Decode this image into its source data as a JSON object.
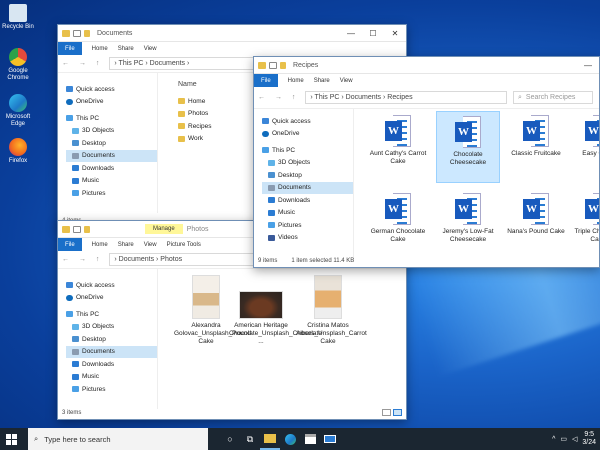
{
  "desktop": {
    "icons": [
      {
        "label": "Recycle Bin",
        "icon": "recycle-bin-icon",
        "color": "#d8e6f2"
      },
      {
        "label": "Google Chrome",
        "icon": "chrome-icon",
        "color": "#e24a3b"
      },
      {
        "label": "Microsoft Edge",
        "icon": "edge-icon",
        "color": "#1fa3c8"
      },
      {
        "label": "Firefox",
        "icon": "firefox-icon",
        "color": "#f36d1e"
      }
    ]
  },
  "docs_window": {
    "title": "Documents",
    "ribbon": [
      "File",
      "Home",
      "Share",
      "View"
    ],
    "path": "› This PC › Documents ›",
    "nav": [
      "Quick access",
      "OneDrive",
      "This PC",
      "3D Objects",
      "Desktop",
      "Documents",
      "Downloads",
      "Music",
      "Pictures"
    ],
    "column_header": "Name",
    "items": [
      "Home",
      "Photos",
      "Recipes",
      "Work"
    ],
    "status": "4 items"
  },
  "photos_window": {
    "title": "Photos",
    "manage_tab": "Manage",
    "ribbon": [
      "File",
      "Home",
      "Share",
      "View"
    ],
    "sub_tab": "Picture Tools",
    "path": "› Documents › Photos",
    "nav": [
      "Quick access",
      "OneDrive",
      "This PC",
      "3D Objects",
      "Desktop",
      "Documents",
      "Downloads",
      "Music",
      "Pictures"
    ],
    "files": [
      {
        "name": "Alexandra Golovac_Unsplash_Pound Cake"
      },
      {
        "name": "American Heritage Chocolate_Unsplash_Chocolate ..."
      },
      {
        "name": "Cristina Matos Albers_Unsplash_Carrot Cake"
      }
    ],
    "status": "3 items"
  },
  "recipes_window": {
    "title": "Recipes",
    "ribbon": [
      "File",
      "Home",
      "Share",
      "View"
    ],
    "path": "› This PC › Documents › Recipes",
    "search_placeholder": "Search Recipes",
    "nav": [
      "Quick access",
      "OneDrive",
      "This PC",
      "3D Objects",
      "Desktop",
      "Documents",
      "Downloads",
      "Music",
      "Pictures",
      "Videos"
    ],
    "files": [
      {
        "name": "Aunt Cathy's Carrot Cake"
      },
      {
        "name": "Chocolate Cheesecake"
      },
      {
        "name": "Classic Fruitcake"
      },
      {
        "name": "Easy Cake"
      },
      {
        "name": "German Chocolate Cake"
      },
      {
        "name": "Jeremy's Low-Fat Cheesecake"
      },
      {
        "name": "Nana's Pound Cake"
      },
      {
        "name": "Triple Chocolate Cake"
      }
    ],
    "status_items": "9 items",
    "status_selected": "1 item selected  11.4 KB"
  },
  "taskbar": {
    "search_placeholder": "Type here to search",
    "time": "9:5",
    "date": "3/24"
  },
  "colors": {
    "accent": "#1a6fc9",
    "selection": "#cce4f7",
    "word": "#185abd"
  }
}
